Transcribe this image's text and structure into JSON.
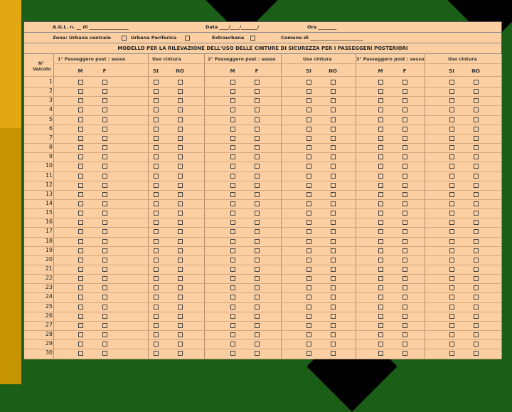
{
  "header": {
    "agl": "A.G.L. n. __ di _________________",
    "data": "Data ____/____/_______/",
    "ora": "Ora ________",
    "zona": "Zona: Urbana centrale",
    "urbana_periferica": "Urbana Periferica",
    "extraurbana": "Extraurbana",
    "comune": "Comune di _______________________",
    "title": "MODELLO PER LA RILEVAZIONE DELL'USO DELLE CINTURE DI SICUREZZA PER I PASSEGGERI POSTERIORI"
  },
  "columns": {
    "veicolo": "N° Veicolo",
    "pass1": "1° Passeggero post : sesso",
    "uso1": "Uso cintura",
    "pass2": "2° Passeggero post : sesso",
    "uso2": "Uso cintura",
    "pass3": "3° Passeggero post : sesso",
    "uso3": "Uso cintura",
    "m": "M",
    "f": "F",
    "si": "SI",
    "no": "NO"
  },
  "rows": [
    "1",
    "2",
    "3",
    "4",
    "5",
    "6",
    "7",
    "8",
    "9",
    "10",
    "11",
    "12",
    "13",
    "14",
    "15",
    "16",
    "17",
    "18",
    "19",
    "20",
    "21",
    "22",
    "23",
    "24",
    "25",
    "26",
    "27",
    "28",
    "29",
    "30"
  ]
}
